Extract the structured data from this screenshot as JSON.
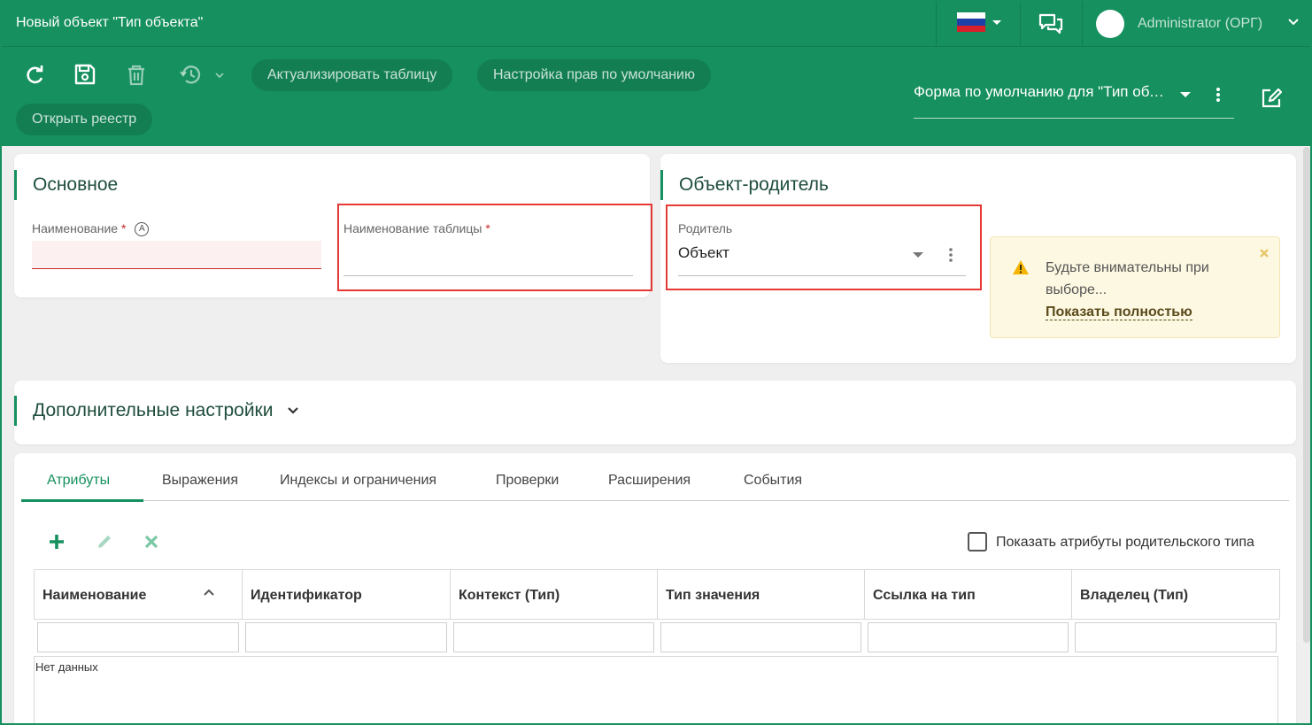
{
  "window": {
    "title": "Новый объект \"Тип объекта\""
  },
  "header": {
    "language_flag": "flag-ru-icon",
    "user_name": "Administrator (ОРГ)"
  },
  "toolbar": {
    "refresh_icon": "refresh-icon",
    "save_icon": "save-icon",
    "delete_icon": "delete-icon",
    "history_icon": "history-icon",
    "actualize_label": "Актуализировать таблицу",
    "default_rights_label": "Настройка прав по умолчанию",
    "open_registry_label": "Открыть реестр",
    "form_select_value": "Форма по умолчанию для \"Тип объекта\""
  },
  "basic": {
    "title": "Основное",
    "name_label": "Наименование",
    "name_value": "",
    "table_name_label": "Наименование таблицы",
    "table_name_value": ""
  },
  "parent": {
    "title": "Объект-родитель",
    "parent_label": "Родитель",
    "parent_value": "Объект",
    "warning_text": "Будьте внимательны при выборе...",
    "warning_link": "Показать полностью"
  },
  "additional": {
    "title": "Дополнительные настройки"
  },
  "tabs": [
    {
      "label": "Атрибуты",
      "active": true
    },
    {
      "label": "Выражения"
    },
    {
      "label": "Индексы и ограничения"
    },
    {
      "label": "Проверки"
    },
    {
      "label": "Расширения"
    },
    {
      "label": "События"
    }
  ],
  "attributes": {
    "show_parent_label": "Показать атрибуты родительского типа",
    "columns": [
      "Наименование",
      "Идентификатор",
      "Контекст (Тип)",
      "Тип значения",
      "Ссылка на тип",
      "Владелец (Тип)"
    ],
    "empty_text": "Нет данных"
  },
  "colors": {
    "brand": "#15905e",
    "required": "#c62828",
    "highlight": "#e53935",
    "warning_bg": "#fdf8e1"
  }
}
